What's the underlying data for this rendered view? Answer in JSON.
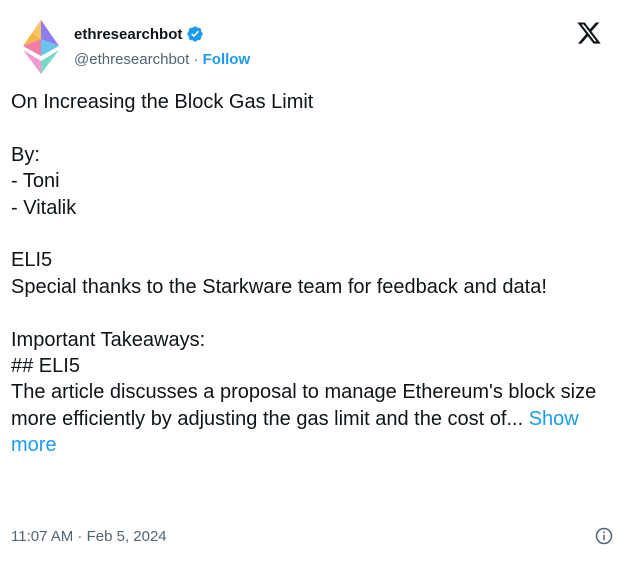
{
  "author": {
    "display_name": "ethresearchbot",
    "handle": "@ethresearchbot",
    "separator": " · ",
    "follow_label": "Follow",
    "avatar_icon": "ethereum-logo-icon",
    "verified_icon": "verified-badge-icon"
  },
  "platform_icon": "x-logo-icon",
  "tweet": {
    "title": "On Increasing the Block Gas Limit",
    "by_label": "By:",
    "authors": [
      "- Toni",
      "- Vitalik"
    ],
    "eli5_heading": "ELI5",
    "thanks": "Special thanks to the Starkware team for feedback and data!",
    "takeaways_heading": "Important Takeaways:",
    "md_heading": "## ELI5",
    "summary": "The article discusses a proposal to manage Ethereum's block size more efficiently by adjusting the gas limit and the cost of...",
    "show_more_label": "Show more"
  },
  "timestamp": "11:07 AM · Feb 5, 2024",
  "info_icon": "info-icon",
  "colors": {
    "accent": "#1d9bf0",
    "text": "#0f1419",
    "muted": "#536471"
  }
}
